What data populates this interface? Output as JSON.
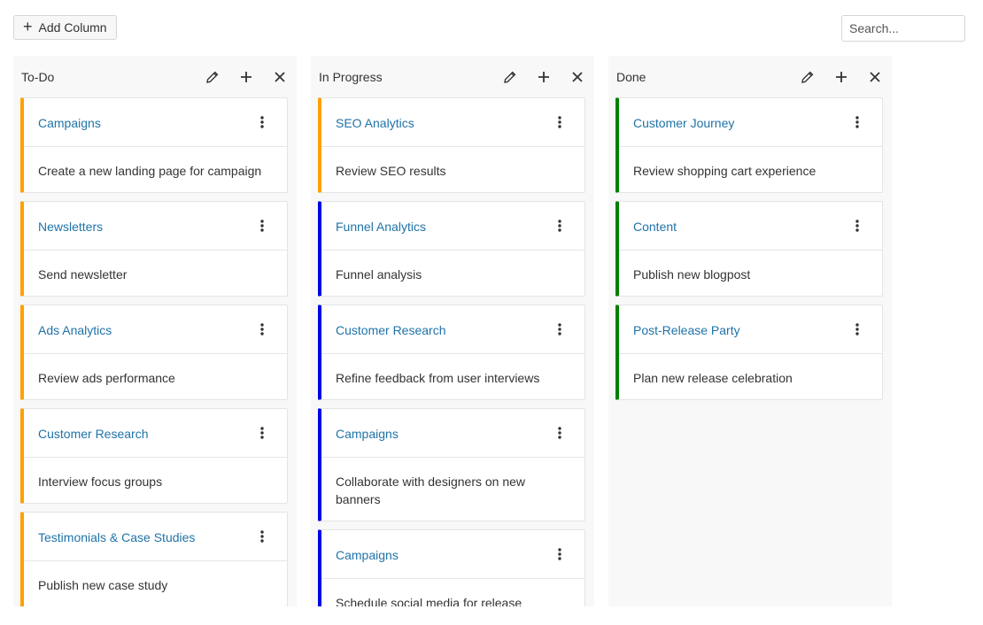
{
  "toolbar": {
    "add_column_label": "Add Column",
    "search_placeholder": "Search..."
  },
  "colors": {
    "orange": "#ffa000",
    "blue": "#0000e6",
    "green": "#008000",
    "link": "#1f73a8"
  },
  "columns": [
    {
      "title": "To-Do",
      "cards": [
        {
          "title": "Campaigns",
          "text": "Create a new landing page for campaign",
          "color": "orange"
        },
        {
          "title": "Newsletters",
          "text": "Send newsletter",
          "color": "orange"
        },
        {
          "title": "Ads Analytics",
          "text": "Review ads performance",
          "color": "orange"
        },
        {
          "title": "Customer Research",
          "text": "Interview focus groups",
          "color": "orange"
        },
        {
          "title": "Testimonials & Case Studies",
          "text": "Publish new case study",
          "color": "orange"
        }
      ]
    },
    {
      "title": "In Progress",
      "cards": [
        {
          "title": "SEO Analytics",
          "text": "Review SEO results",
          "color": "orange"
        },
        {
          "title": "Funnel Analytics",
          "text": "Funnel analysis",
          "color": "blue"
        },
        {
          "title": "Customer Research",
          "text": "Refine feedback from user interviews",
          "color": "blue"
        },
        {
          "title": "Campaigns",
          "text": "Collaborate with designers on new banners",
          "color": "blue"
        },
        {
          "title": "Campaigns",
          "text": "Schedule social media for release",
          "color": "blue"
        }
      ]
    },
    {
      "title": "Done",
      "cards": [
        {
          "title": "Customer Journey",
          "text": "Review shopping cart experience",
          "color": "green"
        },
        {
          "title": "Content",
          "text": "Publish new blogpost",
          "color": "green"
        },
        {
          "title": "Post-Release Party",
          "text": "Plan new release celebration",
          "color": "green"
        }
      ]
    }
  ]
}
